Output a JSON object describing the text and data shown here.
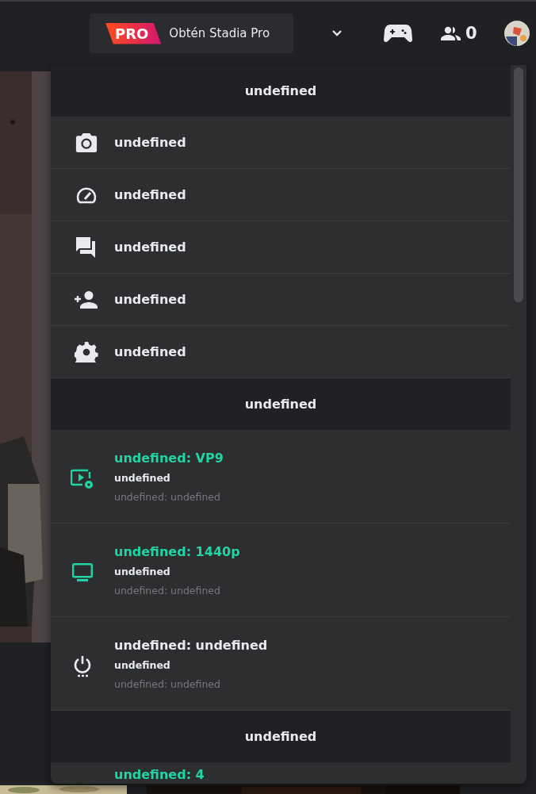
{
  "top_bar": {
    "pro_badge": "PRO",
    "pro_label": "Obtén Stadia Pro",
    "friends_count": "0"
  },
  "menu": {
    "sections": [
      {
        "title": "undefined",
        "kind": "actions",
        "items": [
          {
            "label": "undefined"
          },
          {
            "label": "undefined"
          },
          {
            "label": "undefined"
          },
          {
            "label": "undefined"
          },
          {
            "label": "undefined"
          }
        ]
      },
      {
        "title": "undefined",
        "kind": "info",
        "items": [
          {
            "title": "undefined: VP9",
            "subtitle": "undefined",
            "detail": "undefined: undefined",
            "active": true
          },
          {
            "title": "undefined: 1440p",
            "subtitle": "undefined",
            "detail": "undefined: undefined",
            "active": true
          },
          {
            "title": "undefined: undefined",
            "subtitle": "undefined",
            "detail": "undefined: undefined",
            "active": false
          }
        ]
      },
      {
        "title": "undefined",
        "kind": "info",
        "items": [
          {
            "title": "undefined: 4",
            "active": true
          }
        ]
      }
    ]
  }
}
